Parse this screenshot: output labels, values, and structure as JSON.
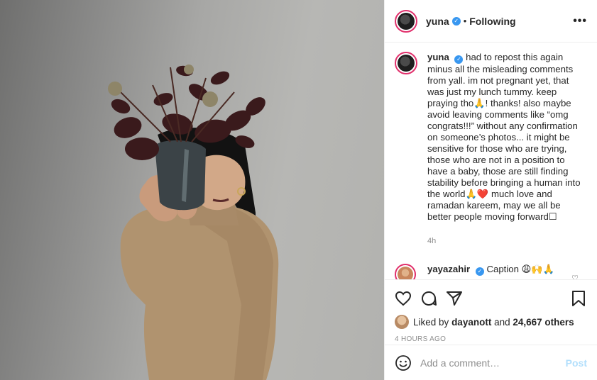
{
  "header": {
    "username": "yuna",
    "separator": "•",
    "follow_status": "Following",
    "more_label": "•••"
  },
  "caption": {
    "username": "yuna",
    "text": "had to repost this again minus all the misleading comments from yall. im not pregnant yet, that was just my lunch tummy. keep praying tho🙏! thanks! also maybe avoid leaving comments like “omg congrats!!!” without any confirmation on someone’s photos... it might be sensitive for those who are trying, those who are not in a position to have a baby, those are still finding stability before bringing a human into the world🙏❤️ much love and ramadan kareem, may we all be better people moving forward☐",
    "time": "4h"
  },
  "reply": {
    "username": "yayazahir",
    "text": "Caption 😩🙌🙏"
  },
  "likes": {
    "prefix": "Liked by",
    "user": "dayanott",
    "joiner": "and",
    "others": "24,667 others"
  },
  "posted_ago": "4 HOURS AGO",
  "comment_box": {
    "placeholder": "Add a comment…",
    "post_label": "Post"
  },
  "icons": {
    "verified": "verified-badge-icon",
    "like": "heart-icon",
    "comment": "comment-bubble-icon",
    "share": "paper-plane-icon",
    "save": "bookmark-icon",
    "emoji": "smiley-icon"
  },
  "colors": {
    "verified_blue": "#3897f0",
    "story_ring": "#e1306c",
    "post_button_disabled": "#b2dffc",
    "muted_text": "#8e8e8e"
  }
}
